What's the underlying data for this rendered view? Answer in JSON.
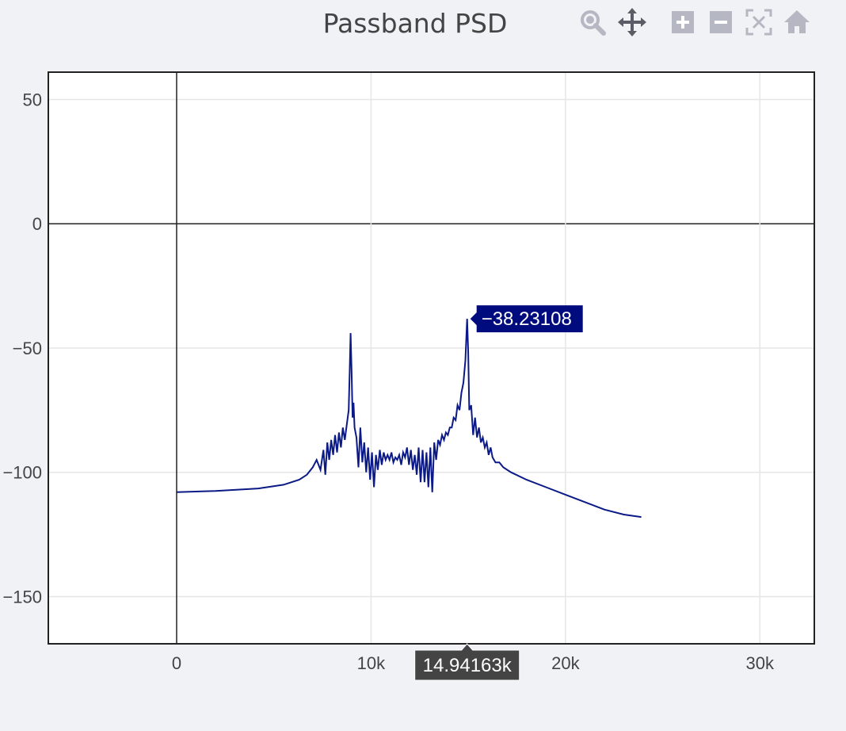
{
  "title": "Passband PSD",
  "modebar": {
    "icons": [
      "zoom-icon",
      "pan-icon",
      "zoom-in-icon",
      "zoom-out-icon",
      "autoscale-icon",
      "reset-axes-icon"
    ]
  },
  "colors": {
    "trace": "#0b1a86",
    "hover_y_bg": "#000c7d",
    "hover_x_bg": "#444444",
    "grid": "#e6e6e6",
    "axis": "#222222"
  },
  "hover": {
    "x_label": "14.94163k",
    "y_label": "−38.23108"
  },
  "chart_data": {
    "type": "line",
    "title": "Passband PSD",
    "xlabel": "",
    "ylabel": "",
    "xlim": [
      -6600,
      32800
    ],
    "ylim": [
      -169,
      61
    ],
    "x_ticks": [
      0,
      10000,
      20000,
      30000
    ],
    "x_tick_labels": [
      "0",
      "10k",
      "20k",
      "30k"
    ],
    "y_ticks": [
      50,
      0,
      -50,
      -100,
      -150
    ],
    "y_tick_labels": [
      "50",
      "0",
      "−50",
      "−100",
      "−150"
    ],
    "grid": true,
    "zeroline": true,
    "series": [
      {
        "x": [
          0,
          2000,
          4200,
          5500,
          6300,
          6700,
          7000,
          7200,
          7400,
          7550,
          7650,
          7750,
          7850,
          7950,
          8050,
          8150,
          8250,
          8350,
          8450,
          8550,
          8650,
          8750,
          8850,
          8900,
          8950,
          9000,
          9050,
          9100,
          9150,
          9250,
          9350,
          9450,
          9550,
          9650,
          9750,
          9850,
          9950,
          10050,
          10150,
          10250,
          10350,
          10450,
          10550,
          10650,
          10750,
          10850,
          10950,
          11050,
          11150,
          11250,
          11350,
          11450,
          11550,
          11650,
          11750,
          11850,
          11950,
          12050,
          12150,
          12250,
          12350,
          12450,
          12550,
          12650,
          12750,
          12850,
          12950,
          13050,
          13150,
          13250,
          13350,
          13450,
          13550,
          13650,
          13750,
          13850,
          13950,
          14050,
          14150,
          14250,
          14350,
          14450,
          14550,
          14650,
          14750,
          14850,
          14941.63,
          15000,
          15050,
          15150,
          15250,
          15350,
          15450,
          15550,
          15650,
          15750,
          15850,
          15950,
          16050,
          16150,
          16250,
          16400,
          16600,
          16800,
          17200,
          18000,
          19000,
          20000,
          21000,
          22000,
          23000,
          23900
        ],
        "y": [
          -108,
          -107.5,
          -106.5,
          -105,
          -103,
          -101,
          -98,
          -95,
          -99,
          -91,
          -101,
          -88,
          -95,
          -87,
          -93,
          -85,
          -92,
          -84,
          -90,
          -82,
          -87,
          -81,
          -75,
          -60,
          -44,
          -60,
          -78,
          -72,
          -82,
          -86,
          -98,
          -82,
          -96,
          -88,
          -100,
          -90,
          -103,
          -92,
          -106,
          -93,
          -99,
          -91,
          -97,
          -92,
          -95,
          -93,
          -95,
          -92,
          -96,
          -94,
          -95,
          -93,
          -97,
          -92,
          -94,
          -90,
          -97,
          -91,
          -99,
          -93,
          -101,
          -90,
          -104,
          -91,
          -104,
          -92,
          -106,
          -90,
          -108,
          -88,
          -95,
          -87,
          -89,
          -85,
          -87,
          -84,
          -85,
          -82,
          -82,
          -78,
          -79,
          -73,
          -75,
          -68,
          -64,
          -55,
          -38.23,
          -52,
          -75,
          -73,
          -85,
          -78,
          -86,
          -82,
          -88,
          -86,
          -90,
          -88,
          -93,
          -90,
          -94,
          -96,
          -96,
          -98,
          -100,
          -103,
          -106,
          -109,
          -112,
          -115,
          -117,
          -118
        ]
      }
    ]
  }
}
